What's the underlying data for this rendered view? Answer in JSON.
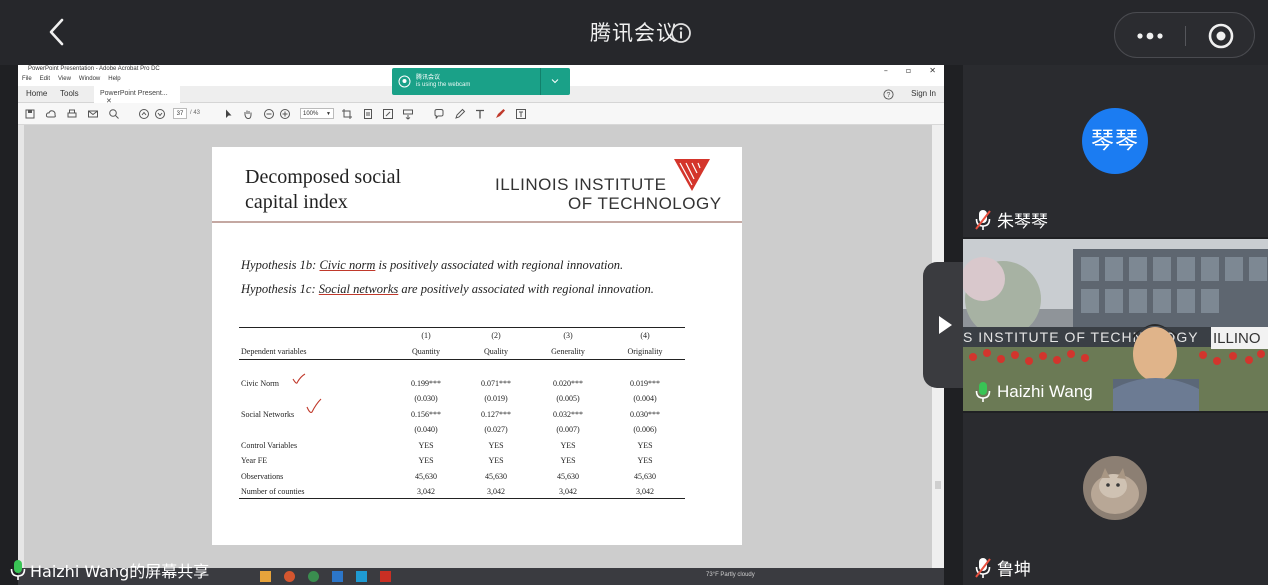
{
  "header": {
    "title": "腾讯会议",
    "back_icon": "chevron-left-icon",
    "info_icon": "info-icon",
    "more_icon": "more-dots-icon",
    "record_icon": "record-icon"
  },
  "shared_screen": {
    "window_title": "PowerPoint Presentation - Adobe Acrobat Pro DC",
    "menu": [
      "File",
      "Edit",
      "View",
      "Window",
      "Help"
    ],
    "tabs": [
      "Home",
      "Tools"
    ],
    "doc_tab": "PowerPoint Present...",
    "signin": "Sign In",
    "page_current": "37",
    "page_total": "/ 43",
    "zoom": "100%",
    "webcam_popup": {
      "line1": "腾讯会议",
      "line2": "is using the webcam"
    },
    "slide": {
      "title_line1": "Decomposed social",
      "title_line2": "capital index",
      "logo_line1": "ILLINOIS INSTITUTE",
      "logo_line2": "OF TECHNOLOGY",
      "hypothesis_1b": {
        "prefix": "Hypothesis 1b: ",
        "term": "Civic norm",
        "suffix": " is positively associated with regional innovation."
      },
      "hypothesis_1c": {
        "prefix": "Hypothesis 1c: ",
        "term": "Social networks",
        "suffix": " are positively associated with regional innovation."
      },
      "table": {
        "col_numbers": [
          "(1)",
          "(2)",
          "(3)",
          "(4)"
        ],
        "dep_label": "Dependent variables",
        "col_headers": [
          "Quantity",
          "Quality",
          "Generality",
          "Originality"
        ],
        "rows": [
          {
            "label": "Civic Norm",
            "values": [
              "0.199***",
              "0.071***",
              "0.020***",
              "0.019***"
            ]
          },
          {
            "label": "",
            "values": [
              "(0.030)",
              "(0.019)",
              "(0.005)",
              "(0.004)"
            ]
          },
          {
            "label": "Social Networks",
            "values": [
              "0.156***",
              "0.127***",
              "0.032***",
              "0.030***"
            ]
          },
          {
            "label": "",
            "values": [
              "(0.040)",
              "(0.027)",
              "(0.007)",
              "(0.006)"
            ]
          },
          {
            "label": "Control Variables",
            "values": [
              "YES",
              "YES",
              "YES",
              "YES"
            ]
          },
          {
            "label": "Year FE",
            "values": [
              "YES",
              "YES",
              "YES",
              "YES"
            ]
          },
          {
            "label": "Observations",
            "values": [
              "45,630",
              "45,630",
              "45,630",
              "45,630"
            ]
          },
          {
            "label": "Number of counties",
            "values": [
              "3,042",
              "3,042",
              "3,042",
              "3,042"
            ]
          }
        ]
      }
    },
    "taskbar_tray": "73°F Partly cloudy"
  },
  "share_label": "Haizhi Wang的屏幕共享",
  "participants": [
    {
      "name": "朱琴琴",
      "avatar_text": "琴琴",
      "mic": "muted"
    },
    {
      "name": "Haizhi Wang",
      "mic": "active",
      "video": true
    },
    {
      "name": "鲁坤",
      "mic": "muted",
      "avatar": "cat-photo"
    }
  ],
  "colors": {
    "accent_blue": "#1b7cf2",
    "popup_green": "#1aa188",
    "mic_green": "#39c455",
    "mic_muted_red": "#e9503f"
  }
}
